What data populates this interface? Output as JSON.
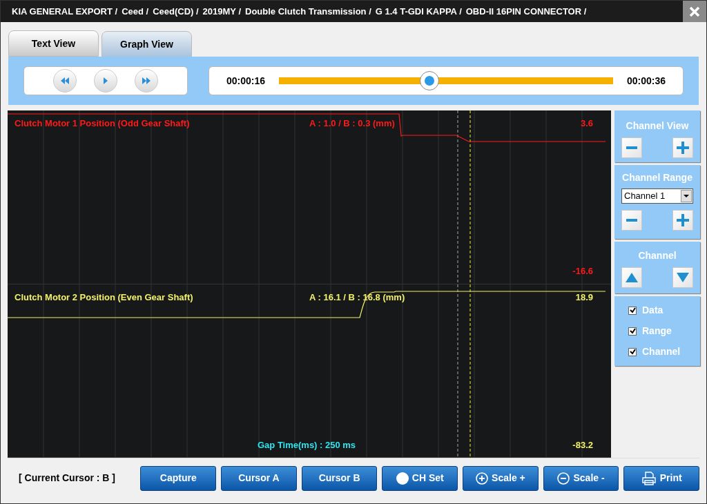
{
  "window": {
    "breadcrumb": [
      "KIA GENERAL EXPORT /",
      "Ceed /",
      "Ceed(CD) /",
      "2019MY /",
      "Double Clutch Transmission /",
      "G 1.4 T-GDI KAPPA /",
      "OBD-II 16PIN CONNECTOR /"
    ]
  },
  "tabs": [
    {
      "label": "Text View",
      "selected": false
    },
    {
      "label": "Graph View",
      "selected": true
    }
  ],
  "player": {
    "current_time": "00:00:16",
    "total_time": "00:00:36",
    "level": 0.45
  },
  "graph": {
    "channels": [
      {
        "name": "Clutch Motor 1 Position (Odd Gear Shaft)",
        "reading": "A : 1.0 / B : 0.3 (mm)",
        "max": "3.6",
        "min": "-16.6",
        "color": "#ff1a1a"
      },
      {
        "name": "Clutch Motor 2 Position (Even Gear Shaft)",
        "reading": "A : 16.1 / B : 16.8 (mm)",
        "max": "18.9",
        "min": "-83.2",
        "color": "#f2f26a"
      }
    ],
    "gap_time": "Gap Time(ms) : 250 ms"
  },
  "side_panel": {
    "channel_view": {
      "title": "Channel View"
    },
    "channel_range": {
      "title": "Channel Range",
      "select_value": "Channel 1"
    },
    "channel": {
      "title": "Channel"
    },
    "options": [
      {
        "label": "Data",
        "checked": true
      },
      {
        "label": "Range",
        "checked": true
      },
      {
        "label": "Channel",
        "checked": true
      }
    ]
  },
  "footer": {
    "current_cursor": "[ Current Cursor : B ]",
    "buttons": [
      {
        "label": "Capture",
        "kind": "plain"
      },
      {
        "label": "Cursor A",
        "kind": "plain"
      },
      {
        "label": "Cursor B",
        "kind": "plain"
      },
      {
        "label": "CH Set",
        "kind": "dot"
      },
      {
        "label": "Scale +",
        "kind": "plus"
      },
      {
        "label": "Scale -",
        "kind": "minus"
      },
      {
        "label": "Print",
        "kind": "print"
      }
    ]
  }
}
